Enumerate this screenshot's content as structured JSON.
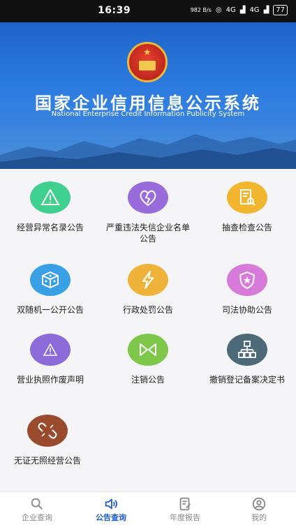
{
  "status_bar": {
    "time": "16:39",
    "network_speed": "982 B/s",
    "signal_1": "4G",
    "signal_2": "4G",
    "battery": "77"
  },
  "banner": {
    "title": "国家企业信用信息公示系统",
    "subtitle": "National Enterprise Credit Information Publicity System"
  },
  "grid": {
    "items": [
      {
        "label": "经营异常名录公告",
        "color": "#3fcf8e",
        "icon": "warning-triangle-icon"
      },
      {
        "label": "严重违法失信企业名单公告",
        "color": "#9a6cdb",
        "icon": "broken-heart-icon"
      },
      {
        "label": "抽查检查公告",
        "color": "#f2b62e",
        "icon": "document-search-icon"
      },
      {
        "label": "双随机一公开公告",
        "color": "#3aa0e6",
        "icon": "dice-icon"
      },
      {
        "label": "行政处罚公告",
        "color": "#f0b33a",
        "icon": "lightning-icon"
      },
      {
        "label": "司法协助公告",
        "color": "#d77ad9",
        "icon": "shield-star-icon"
      },
      {
        "label": "营业执照作废声明",
        "color": "#8a6bd8",
        "icon": "warning-triangle-icon"
      },
      {
        "label": "注销公告",
        "color": "#7dc84a",
        "icon": "cancel-arrows-icon"
      },
      {
        "label": "撤销登记备案决定书",
        "color": "#4d6a78",
        "icon": "org-chart-icon"
      },
      {
        "label": "无证无照经营公告",
        "color": "#9a4b2e",
        "icon": "broken-link-icon"
      }
    ]
  },
  "tabbar": {
    "tabs": [
      {
        "label": "企业查询",
        "icon": "search-icon"
      },
      {
        "label": "公告查询",
        "icon": "speaker-icon"
      },
      {
        "label": "年度报告",
        "icon": "report-edit-icon"
      },
      {
        "label": "我的",
        "icon": "user-icon"
      }
    ],
    "active_color": "#1e5bd6"
  }
}
